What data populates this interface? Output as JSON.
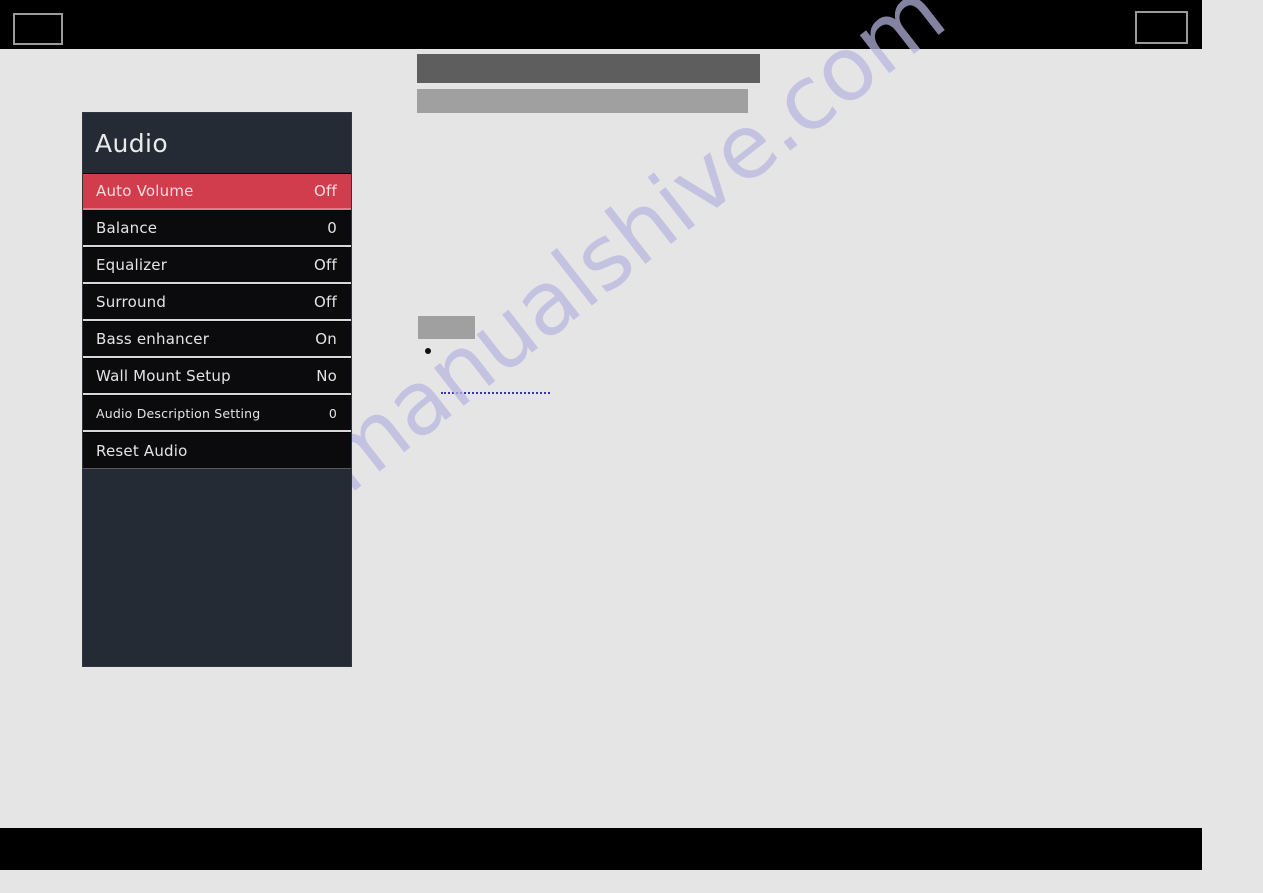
{
  "page": {
    "background_color": "#e5e5e5",
    "chrome_color": "#000000",
    "watermark_text": "manualshive.com",
    "watermark_color": "#b8b5e0"
  },
  "header": {
    "left_box_label": "",
    "right_box_label": ""
  },
  "redactions": {
    "title_bar_color": "#5e5e5e",
    "subtitle_bar_color": "#a0a0a0",
    "small_box_color": "#a0a0a0",
    "link_color": "#3a34b4"
  },
  "osd": {
    "title": "Audio",
    "accent_color": "#d13d4c",
    "panel_color": "#252b35",
    "row_color": "#0b0b0d",
    "items": [
      {
        "label": "Auto Volume",
        "value": "Off",
        "selected": true,
        "small": false
      },
      {
        "label": "Balance",
        "value": "0",
        "selected": false,
        "small": false
      },
      {
        "label": "Equalizer",
        "value": "Off",
        "selected": false,
        "small": false
      },
      {
        "label": "Surround",
        "value": "Off",
        "selected": false,
        "small": false
      },
      {
        "label": "Bass enhancer",
        "value": "On",
        "selected": false,
        "small": false
      },
      {
        "label": "Wall Mount Setup",
        "value": "No",
        "selected": false,
        "small": false
      },
      {
        "label": "Audio Description Setting",
        "value": "0",
        "selected": false,
        "small": true
      },
      {
        "label": "Reset Audio",
        "value": "",
        "selected": false,
        "small": false
      }
    ]
  }
}
